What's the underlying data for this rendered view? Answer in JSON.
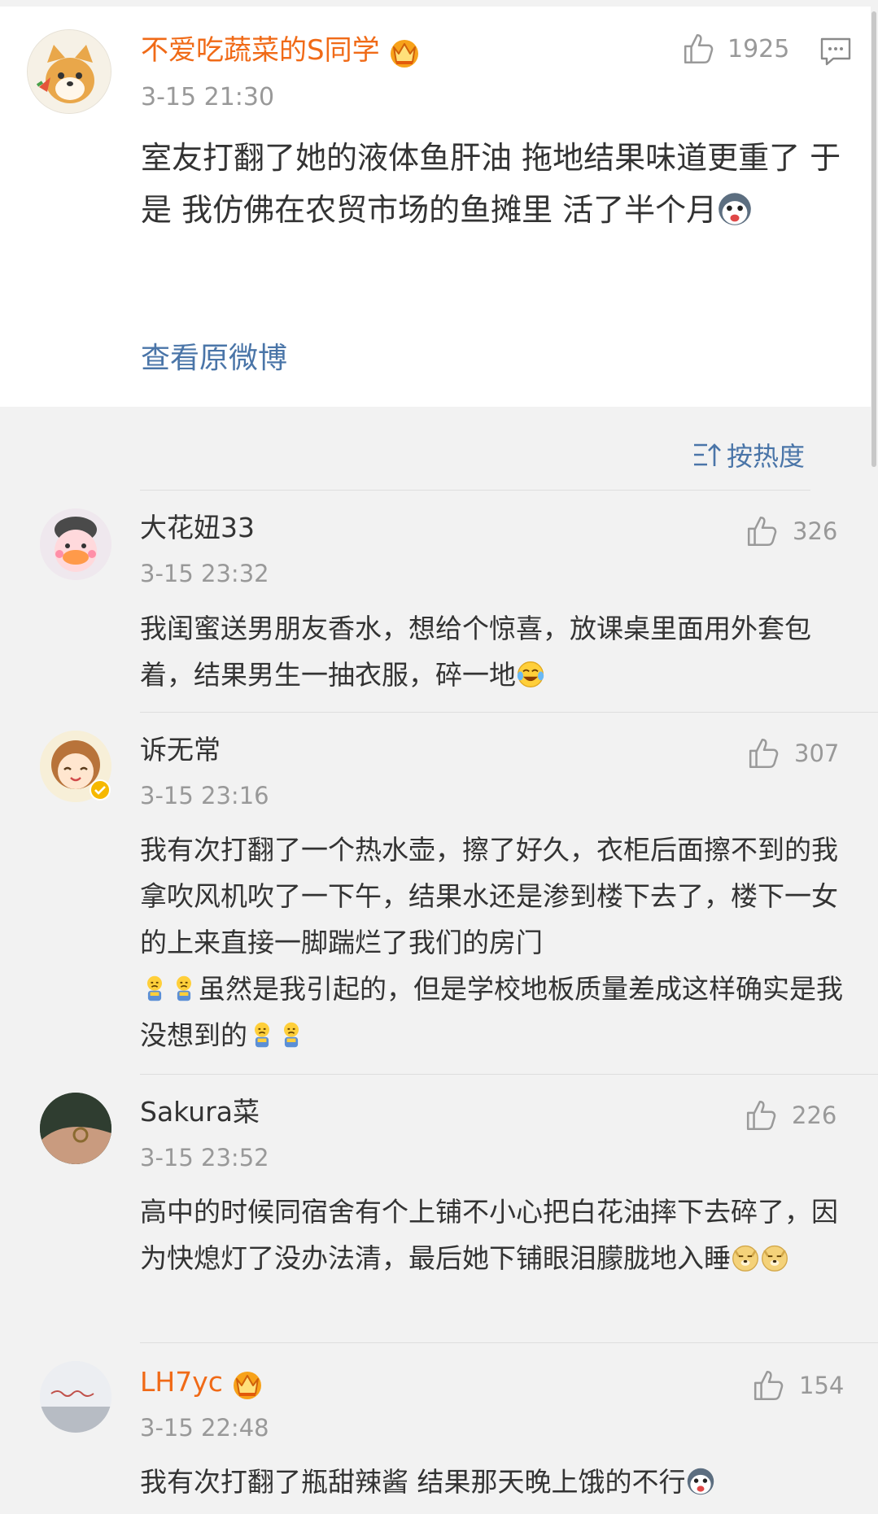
{
  "post": {
    "author": "不爱吃蔬菜的S同学",
    "time": "3-15 21:30",
    "likes": "1925",
    "text": "室友打翻了她的液体鱼肝油 拖地结果味道更重了  于是 我仿佛在农贸市场的鱼摊里  活了半个月",
    "link": "查看原微博"
  },
  "sort_label": "按热度",
  "comments": [
    {
      "name": "大花妞33",
      "time": "3-15 23:32",
      "likes": "326",
      "text": "我闺蜜送男朋友香水，想给个惊喜，放课桌里面用外套包着，结果男生一抽衣服，碎一地"
    },
    {
      "name": "诉无常",
      "time": "3-15 23:16",
      "likes": "307",
      "text1": "我有次打翻了一个热水壶，擦了好久，衣柜后面擦不到的我拿吹风机吹了一下午，结果水还是渗到楼下去了，楼下一女的上来直接一脚踹烂了我们的房门",
      "text2": "虽然是我引起的，但是学校地板质量差成这样确实是我没想到的"
    },
    {
      "name": "Sakura菜",
      "time": "3-15 23:52",
      "likes": "226",
      "text": "高中的时候同宿舍有个上铺不小心把白花油摔下去碎了，因为快熄灯了没办法清，最后她下铺眼泪朦胧地入睡"
    },
    {
      "name": "LH7yc",
      "time": "3-15 22:48",
      "likes": "154",
      "text": "我有次打翻了瓶甜辣酱 结果那天晚上饿的不行"
    }
  ]
}
